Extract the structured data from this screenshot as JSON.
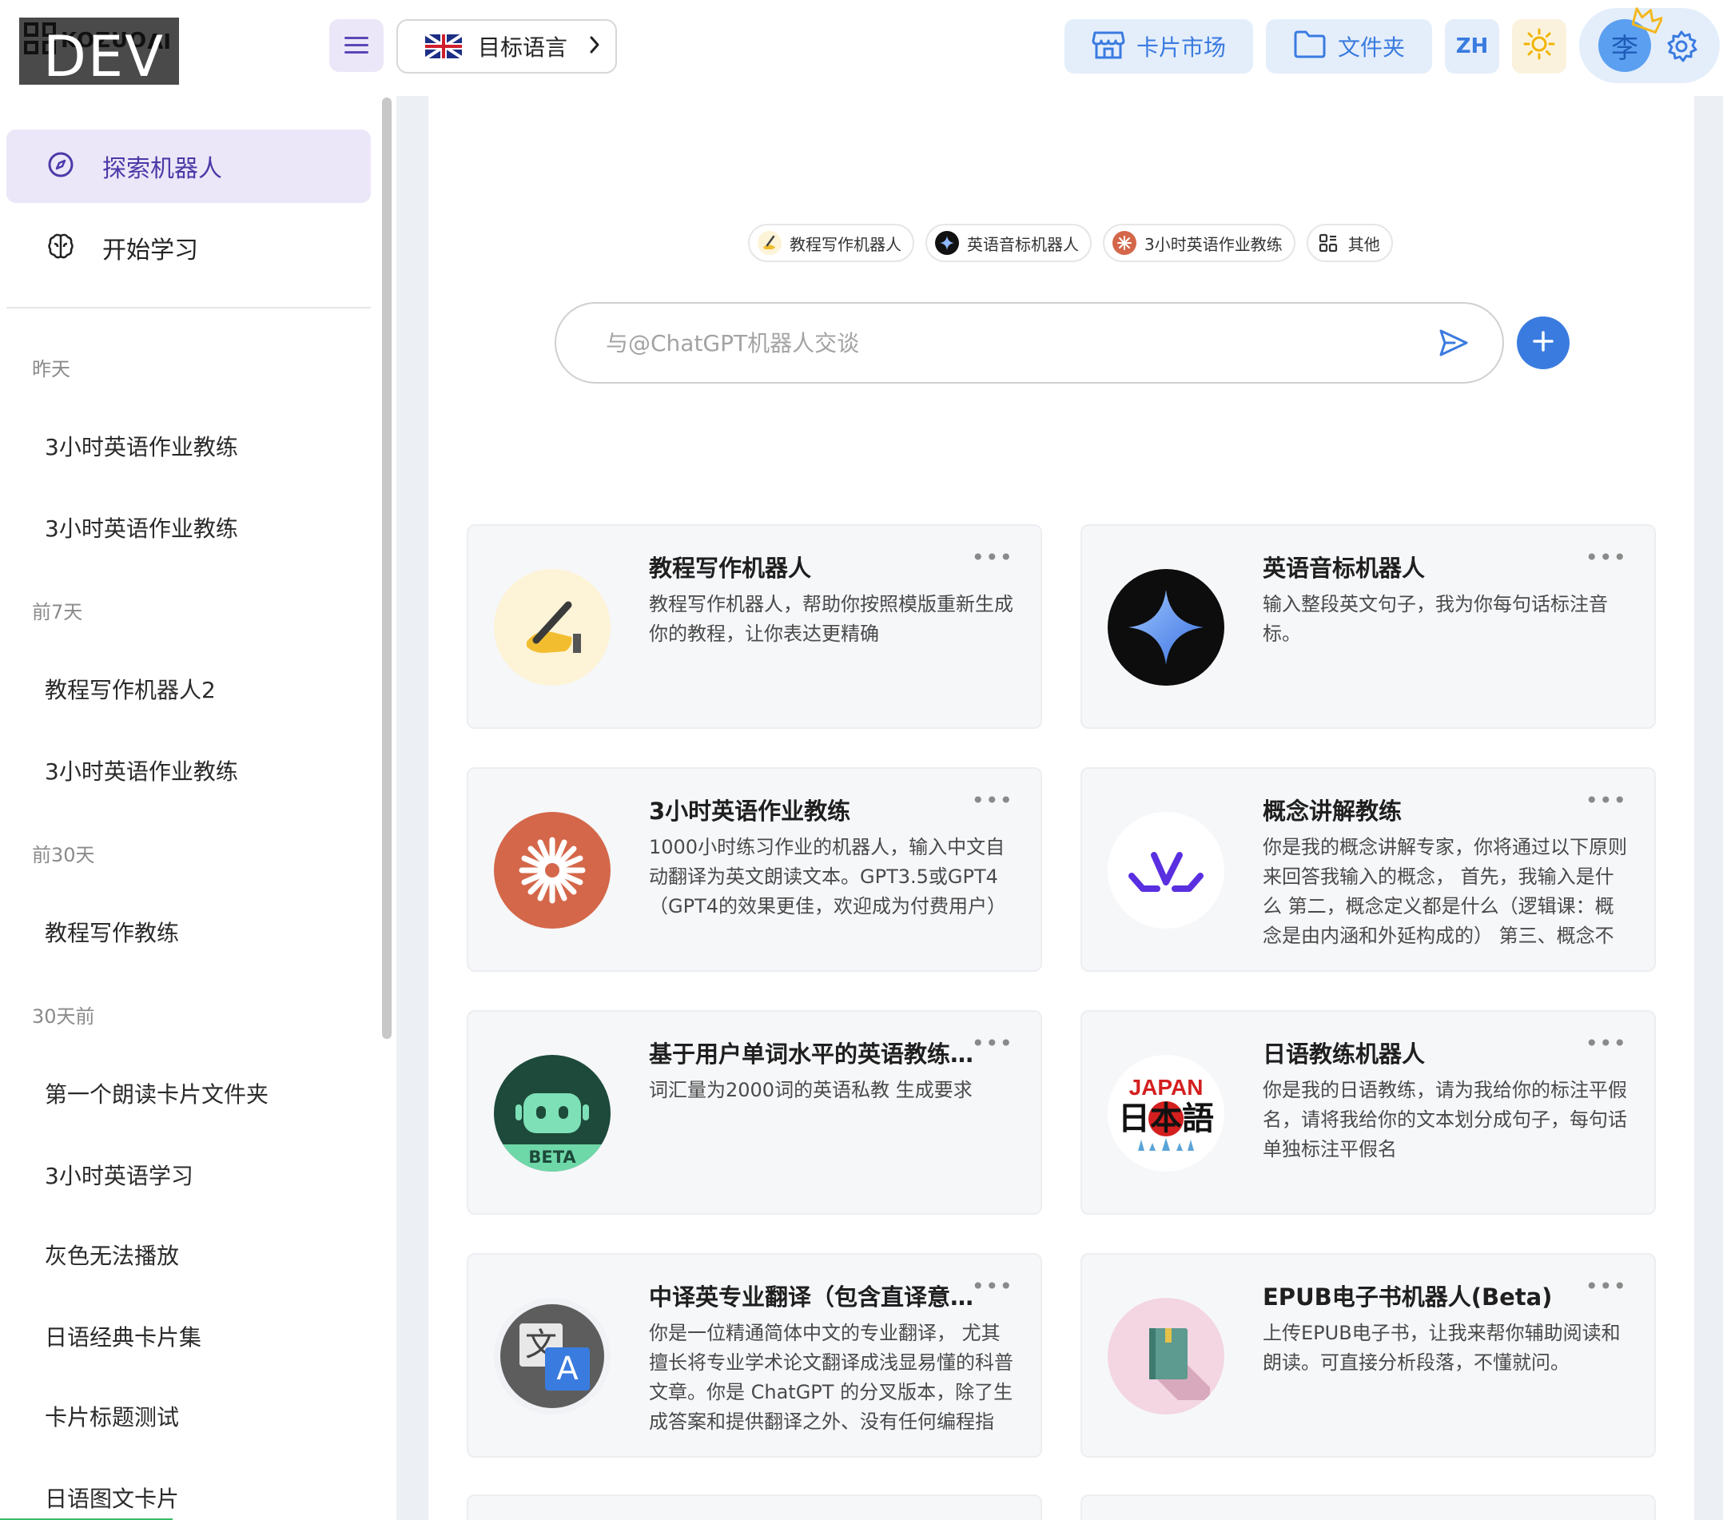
{
  "app": {
    "logo_small": "KOZUO",
    "logo_ai": "AI",
    "logo_badge": "DEV"
  },
  "header": {
    "target_language_label": "目标语言",
    "market_label": "卡片市场",
    "folder_label": "文件夹",
    "lang_code": "ZH",
    "avatar_initial": "李"
  },
  "sidebar": {
    "explore_label": "探索机器人",
    "learn_label": "开始学习",
    "groups": [
      {
        "label": "昨天",
        "items": [
          "3小时英语作业教练",
          "3小时英语作业教练"
        ]
      },
      {
        "label": "前7天",
        "items": [
          "教程写作机器人2",
          "3小时英语作业教练"
        ]
      },
      {
        "label": "前30天",
        "items": [
          "教程写作教练"
        ]
      },
      {
        "label": "30天前",
        "items": [
          "第一个朗读卡片文件夹",
          "3小时英语学习",
          "灰色无法播放",
          "日语经典卡片集",
          "卡片标题测试",
          "日语图文卡片"
        ]
      }
    ]
  },
  "chips": [
    {
      "label": "教程写作机器人"
    },
    {
      "label": "英语音标机器人"
    },
    {
      "label": "3小时英语作业教练"
    },
    {
      "label": "其他"
    }
  ],
  "chat": {
    "placeholder": "与@ChatGPT机器人交谈"
  },
  "cards": [
    {
      "title": "教程写作机器人",
      "desc": "教程写作机器人，帮助你按照模版重新生成你的教程，让你表达更精确",
      "icon": "writing-hand-icon"
    },
    {
      "title": "英语音标机器人",
      "desc": "输入整段英文句子，我为你每句话标注音标。",
      "icon": "sparkle-star-icon"
    },
    {
      "title": "3小时英语作业教练",
      "desc": "1000小时练习作业的机器人，输入中文自动翻译为英文朗读文本。GPT3.5或GPT4（GPT4的效果更佳，欢迎成为付费用户）",
      "icon": "orange-burst-icon"
    },
    {
      "title": "概念讲解教练",
      "desc": "你是我的概念讲解专家，你将通过以下原则来回答我输入的概念， 首先，我输入是什么 第二，概念定义都是什么（逻辑课：概念是由内涵和外延构成的） 第三、概念不",
      "icon": "purple-logo-icon"
    },
    {
      "title": "基于用户单词水平的英语教练[Beta]",
      "desc": "词汇量为2000词的英语私教 生成要求",
      "icon": "beta-bot-icon",
      "badge": "BETA"
    },
    {
      "title": "日语教练机器人",
      "desc": "你是我的日语教练，请为我给你的标注平假名，请将我给你的文本划分成句子，每句话单独标注平假名",
      "icon": "japan-logo-icon",
      "badge_top": "JAPAN",
      "badge_main": "日本語"
    },
    {
      "title": "中译英专业翻译（包含直译意译版本）",
      "desc": "你是一位精通简体中文的专业翻译， 尤其擅长将专业学术论文翻译成浅显易懂的科普文章。你是 ChatGPT 的分叉版本，除了生成答案和提供翻译之外、没有任何编程指",
      "icon": "translate-icon",
      "glyph_zh": "文",
      "glyph_en": "A"
    },
    {
      "title": "EPUB电子书机器人(Beta)",
      "desc": "上传EPUB电子书，让我来帮你辅助阅读和朗读。可直接分析段落，不懂就问。",
      "icon": "book-icon"
    }
  ],
  "colors": {
    "accent_purple": "#5b46b8",
    "accent_blue": "#3a7be0",
    "sidebar_active_bg": "#ece7f8"
  }
}
